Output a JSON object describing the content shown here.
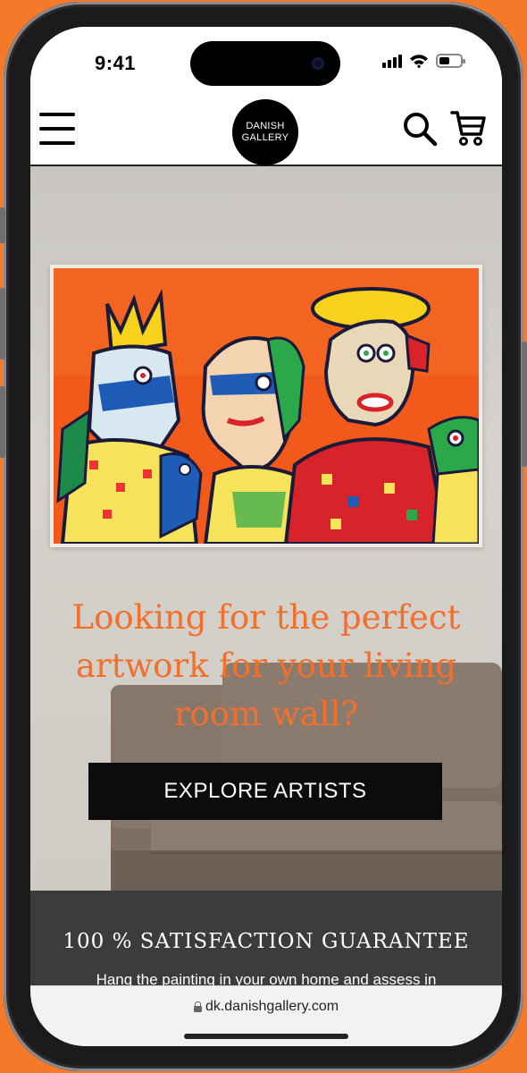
{
  "status_bar": {
    "time": "9:41"
  },
  "header": {
    "logo_line1": "DANISH",
    "logo_line2": "GALLERY",
    "icons": [
      "menu-icon",
      "search-icon",
      "cart-icon"
    ]
  },
  "hero": {
    "headline": "Looking for the perfect artwork for your living room wall?",
    "cta_label": "EXPLORE ARTISTS"
  },
  "guarantee": {
    "title": "100 % SATISFACTION GUARANTEE",
    "text": "Hang the painting in your own home and assess in"
  },
  "browser": {
    "url": "dk.danishgallery.com"
  },
  "colors": {
    "accent_orange": "#f26f2c",
    "background_orange": "#f47a2a",
    "cta_black": "#0c0c0c",
    "guarantee_bg": "#3c3c3c"
  }
}
